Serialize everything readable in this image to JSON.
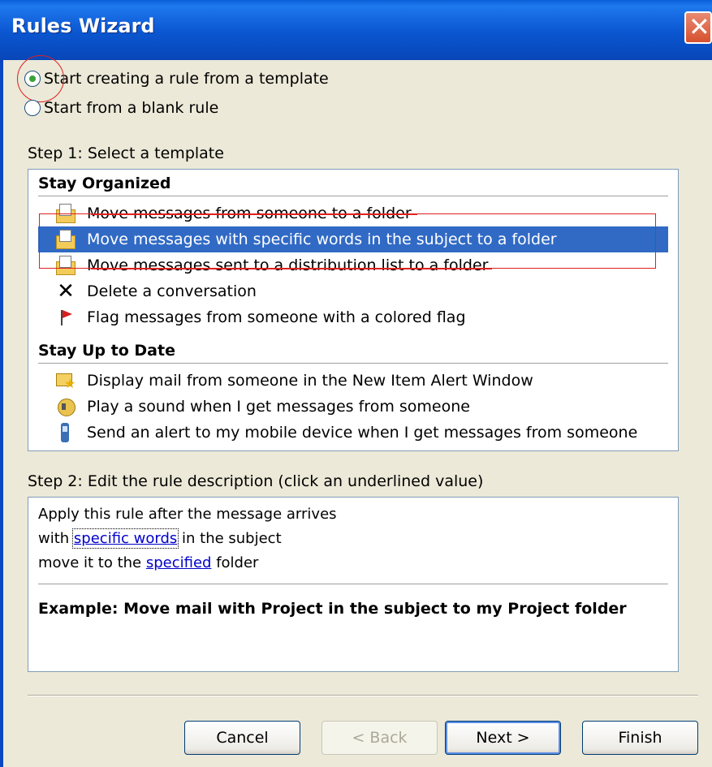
{
  "window": {
    "title": "Rules Wizard",
    "close_glyph": "✕"
  },
  "start_options": [
    {
      "label": "Start creating a rule from a template",
      "selected": true
    },
    {
      "label": "Start from a blank rule",
      "selected": false
    }
  ],
  "step1": {
    "label": "Step 1: Select a template",
    "groups": [
      {
        "header": "Stay Organized",
        "items": [
          {
            "label": "Move messages from someone to a folder",
            "icon": "move-to-folder-icon"
          },
          {
            "label": "Move messages with specific words in the subject to a folder",
            "icon": "move-to-folder-icon",
            "selected": true
          },
          {
            "label": "Move messages sent to a distribution list to a folder",
            "icon": "move-to-folder-icon"
          },
          {
            "label": "Delete a conversation",
            "icon": "delete-icon"
          },
          {
            "label": "Flag messages from someone with a colored flag",
            "icon": "flag-icon"
          }
        ]
      },
      {
        "header": "Stay Up to Date",
        "items": [
          {
            "label": "Display mail from someone in the New Item Alert Window",
            "icon": "new-item-alert-icon"
          },
          {
            "label": "Play a sound when I get messages from someone",
            "icon": "sound-icon"
          },
          {
            "label": "Send an alert to my mobile device when I get messages from someone",
            "icon": "mobile-device-icon"
          }
        ]
      }
    ]
  },
  "step2": {
    "label": "Step 2: Edit the rule description (click an underlined value)",
    "line1": "Apply this rule after the message arrives",
    "line2_prefix": "with ",
    "line2_link": "specific words",
    "line2_suffix": " in the subject",
    "line3_prefix": "move it to the ",
    "line3_link": "specified",
    "line3_suffix": " folder",
    "example": "Example: Move mail with Project in the subject to my Project folder"
  },
  "buttons": {
    "cancel": "Cancel",
    "back": "< Back",
    "next": "Next >",
    "finish": "Finish"
  },
  "colors": {
    "selection": "#316ac5",
    "annotation_red": "#e02020",
    "link": "#0000cc"
  }
}
